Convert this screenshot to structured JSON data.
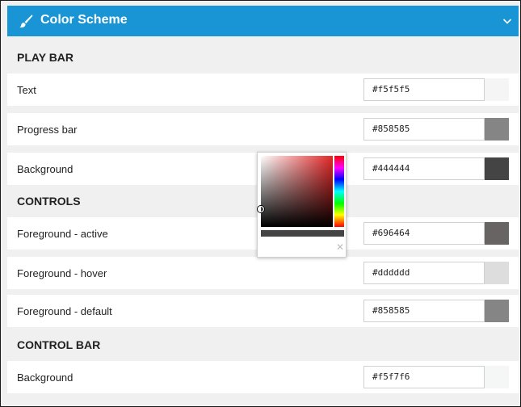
{
  "header": {
    "title": "Color Scheme",
    "brush_icon": "brush-icon",
    "chevron_icon": "chevron-down-icon"
  },
  "sections": [
    {
      "title": "PLAY BAR",
      "rows": [
        {
          "label": "Text",
          "hex": "#f5f5f5",
          "swatch": "#f5f5f5"
        },
        {
          "label": "Progress bar",
          "hex": "#858585",
          "swatch": "#858585"
        },
        {
          "label": "Background",
          "hex": "#444444",
          "swatch": "#444444"
        }
      ]
    },
    {
      "title": "CONTROLS",
      "rows": [
        {
          "label": "Foreground - active",
          "hex": "#696464",
          "swatch": "#696464"
        },
        {
          "label": "Foreground - hover",
          "hex": "#dddddd",
          "swatch": "#dddddd"
        },
        {
          "label": "Foreground - default",
          "hex": "#858585",
          "swatch": "#858585"
        }
      ]
    },
    {
      "title": "CONTROL BAR",
      "rows": [
        {
          "label": "Background",
          "hex": "#f5f7f6",
          "swatch": "#f5f7f6"
        }
      ]
    }
  ],
  "picker": {
    "current_color": "#444444",
    "hue_color": "#e32727",
    "close_glyph": "✕"
  }
}
